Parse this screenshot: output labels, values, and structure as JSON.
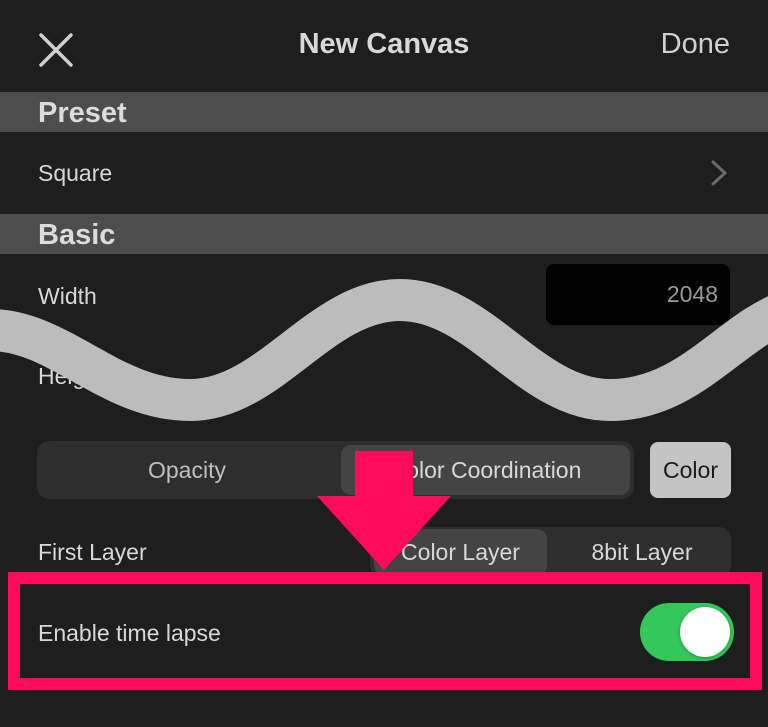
{
  "nav": {
    "title": "New Canvas",
    "done_label": "Done",
    "close_icon": "close-icon"
  },
  "preset": {
    "header": "Preset",
    "row_label": "Square"
  },
  "basic": {
    "header": "Basic",
    "width_label": "Width",
    "width_value": "2048",
    "height_label": "Height",
    "bg_label": "Color"
  },
  "background": {
    "options": [
      "Opacity",
      "Color Coordination"
    ],
    "selected": "Color Coordination",
    "color_button": "Color"
  },
  "first_layer": {
    "label": "First Layer",
    "options": [
      "Color Layer",
      "8bit Layer"
    ],
    "selected": "Color Layer"
  },
  "timelapse": {
    "label": "Enable time lapse",
    "enabled": true
  },
  "colors": {
    "highlight": "#ff0a5c",
    "toggle_on": "#34c759",
    "wave": "#bcbcbc"
  }
}
